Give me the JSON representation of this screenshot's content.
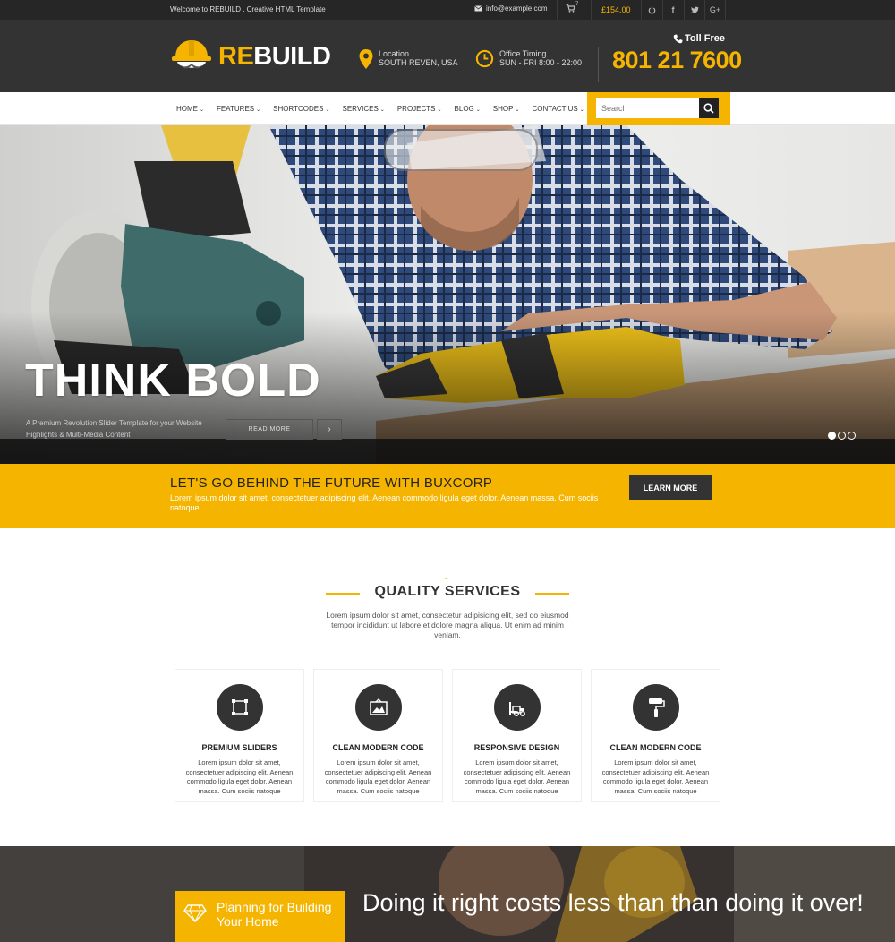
{
  "topbar": {
    "welcome": "Welcome to REBUILD . Creative HTML Template",
    "email": "info@example.com",
    "cart_count": "7",
    "cart_total": "£154.00",
    "icons": [
      "power-icon",
      "facebook-icon",
      "twitter-icon",
      "google-plus-icon"
    ]
  },
  "header": {
    "logo_re": "RE",
    "logo_build": "BUILD",
    "location_label": "Location",
    "location_value": "SOUTH REVEN, USA",
    "timing_label": "Office Timing",
    "timing_value": "SUN - FRI 8:00 - 22:00",
    "toll_free_label": "Toll Free",
    "phone": "801 21 7600"
  },
  "nav": {
    "items": [
      {
        "label": "HOME"
      },
      {
        "label": "FEATURES"
      },
      {
        "label": "SHORTCODES"
      },
      {
        "label": "SERVICES"
      },
      {
        "label": "PROJECTS"
      },
      {
        "label": "BLOG"
      },
      {
        "label": "SHOP"
      },
      {
        "label": "CONTACT US"
      }
    ],
    "search_placeholder": "Search"
  },
  "hero": {
    "title": "THINK BOLD",
    "subtitle": "A Premium Revolution Slider Template for your Website Highlights & Multi-Media Content",
    "read_more": "READ MORE",
    "active_slide": 1,
    "slide_count": 3
  },
  "cta": {
    "title": "LET'S GO BEHIND THE FUTURE WITH BUXCORP",
    "text": "Lorem ipsum dolor sit amet, consectetuer adipiscing elit. Aenean commodo ligula eget dolor. Aenean massa. Cum sociis natoque",
    "button": "LEARN MORE"
  },
  "services": {
    "title": "QUALITY SERVICES",
    "description": "Lorem ipsum dolor sit amet, consectetur adipisicing elit, sed do eiusmod tempor incididunt ut labore et dolore magna aliqua. Ut enim ad minim veniam.",
    "cards": [
      {
        "title": "PREMIUM SLIDERS",
        "icon": "crop-frame-icon",
        "text": "Lorem ipsum dolor sit amet, consectetuer adipiscing elit. Aenean commodo ligula eget dolor. Aenean massa. Cum sociis natoque"
      },
      {
        "title": "CLEAN MODERN CODE",
        "icon": "picture-frame-icon",
        "text": "Lorem ipsum dolor sit amet, consectetuer adipiscing elit. Aenean commodo ligula eget dolor. Aenean massa. Cum sociis natoque"
      },
      {
        "title": "RESPONSIVE DESIGN",
        "icon": "forklift-icon",
        "text": "Lorem ipsum dolor sit amet, consectetuer adipiscing elit. Aenean commodo ligula eget dolor. Aenean massa. Cum sociis natoque"
      },
      {
        "title": "CLEAN MODERN CODE",
        "icon": "paint-roller-icon",
        "text": "Lorem ipsum dolor sit amet, consectetuer adipiscing elit. Aenean commodo ligula eget dolor. Aenean massa. Cum sociis natoque"
      }
    ]
  },
  "bottom": {
    "plan_title": "Planning for Building Your Home",
    "quote": "Doing it right costs less than than doing it over!"
  },
  "colors": {
    "accent": "#f5b400",
    "dark": "#333333",
    "topbar": "#262626"
  }
}
